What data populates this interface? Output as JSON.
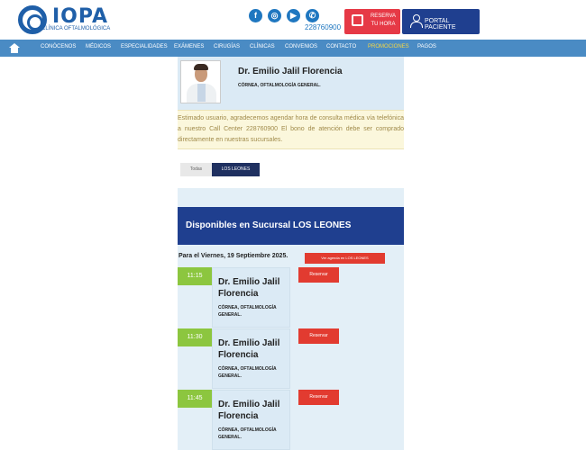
{
  "header": {
    "logo_text": "IOPA",
    "logo_sub": "CLÍNICA OFTALMOLÓGICA",
    "social_icons": [
      "facebook-icon",
      "instagram-icon",
      "youtube-icon",
      "phone-icon"
    ],
    "social_glyphs": [
      "f",
      "◎",
      "▶",
      "✆"
    ],
    "phone": "228760900",
    "reserva_label": "RESERVA TU HORA",
    "portal_label": "PORTAL PACIENTE"
  },
  "nav": {
    "items": [
      "CONÓCENOS",
      "MÉDICOS",
      "ESPECIALIDADES",
      "EXÁMENES",
      "CIRUGÍAS",
      "CLÍNICAS",
      "CONVENIOS",
      "CONTACTO",
      "PROMOCIONES",
      "PAGOS"
    ],
    "active": "PROMOCIONES"
  },
  "doctor": {
    "name": "Dr. Emilio Jalil Florencia",
    "specialty": "CÓRNEA, OFTALMOLOGÍA GENERAL."
  },
  "notice": "Estimado usuario, agradecemos agendar hora de consulta médica vía telefónica a nuestro Call Center 228760900 El bono de atención debe ser comprado directamente en nuestras sucursales.",
  "tabs": [
    "Todas",
    "LOS LEONES"
  ],
  "banner": "Disponibles en Sucursal LOS LEONES",
  "date_line": "Para el Viernes, 19 Septiembre 2025.",
  "agenda_button": "Ver agenda en LOS LEONES",
  "slots": [
    {
      "time": "11:15",
      "name": "Dr. Emilio Jalil Florencia",
      "specialty": "CÓRNEA, OFTALMOLOGÍA GENERAL.",
      "action": "Reservar"
    },
    {
      "time": "11:30",
      "name": "Dr. Emilio Jalil Florencia",
      "specialty": "CÓRNEA, OFTALMOLOGÍA GENERAL.",
      "action": "Reservar"
    },
    {
      "time": "11:45",
      "name": "Dr. Emilio Jalil Florencia",
      "specialty": "CÓRNEA, OFTALMOLOGÍA GENERAL.",
      "action": "Reservar"
    }
  ],
  "colors": {
    "nav_bg": "#4a8bc4",
    "brand_blue": "#1f3f8f",
    "reserve_red": "#e23b30",
    "time_green": "#8cc63f",
    "active_nav": "#f6d743"
  }
}
